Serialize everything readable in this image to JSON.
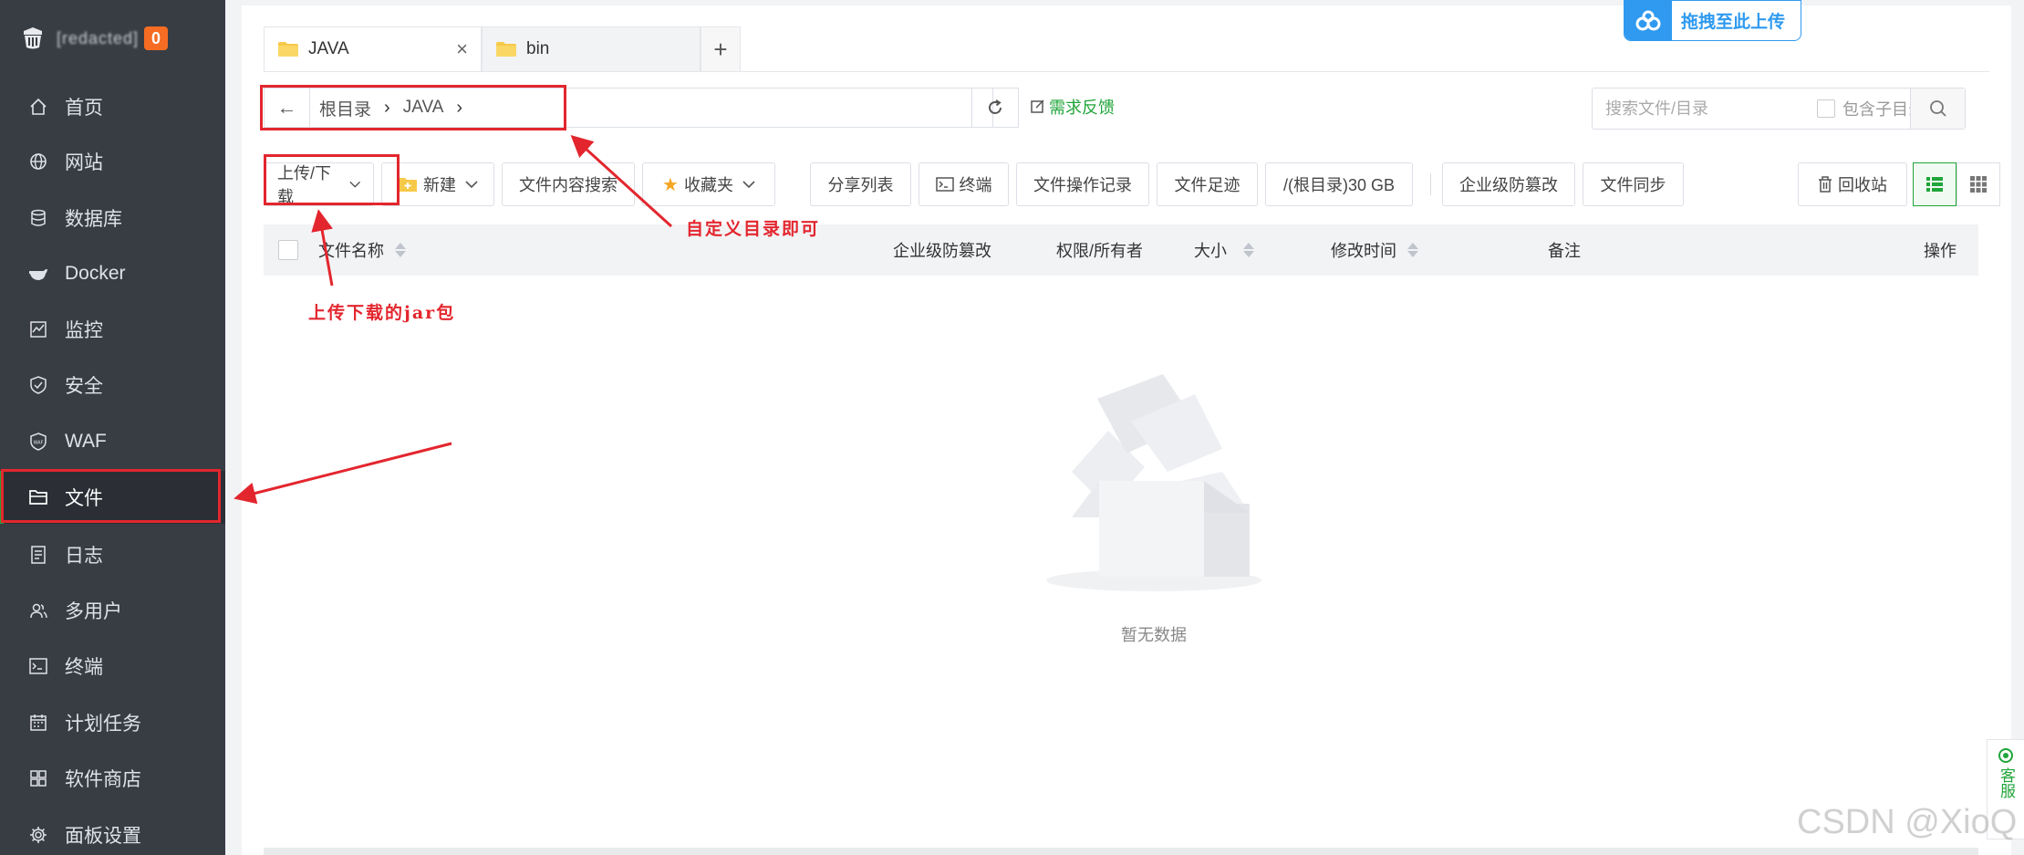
{
  "sidebar": {
    "brand_name": "[redacted]",
    "badge": "0",
    "items": [
      {
        "label": "首页",
        "icon": "home-icon"
      },
      {
        "label": "网站",
        "icon": "globe-icon"
      },
      {
        "label": "数据库",
        "icon": "database-icon"
      },
      {
        "label": "Docker",
        "icon": "docker-icon"
      },
      {
        "label": "监控",
        "icon": "monitor-icon"
      },
      {
        "label": "安全",
        "icon": "shield-icon"
      },
      {
        "label": "WAF",
        "icon": "waf-icon"
      },
      {
        "label": "文件",
        "icon": "folder-icon",
        "active": true
      },
      {
        "label": "日志",
        "icon": "log-icon"
      },
      {
        "label": "多用户",
        "icon": "users-icon"
      },
      {
        "label": "终端",
        "icon": "terminal-icon"
      },
      {
        "label": "计划任务",
        "icon": "calendar-icon"
      },
      {
        "label": "软件商店",
        "icon": "apps-icon"
      },
      {
        "label": "面板设置",
        "icon": "gear-icon"
      }
    ]
  },
  "tabs": [
    {
      "label": "JAVA",
      "active": true
    },
    {
      "label": "bin",
      "active": false
    }
  ],
  "upload_float": {
    "label": "拖拽至此上传"
  },
  "path": {
    "root": "根目录",
    "current": "JAVA"
  },
  "feedback": "需求反馈",
  "search": {
    "placeholder": "搜索文件/目录",
    "include_sub": "包含子目录"
  },
  "toolbar": {
    "upload_download": "上传/下载",
    "new": "新建",
    "content_search": "文件内容搜索",
    "favorites": "收藏夹",
    "share_list": "分享列表",
    "terminal": "终端",
    "op_log": "文件操作记录",
    "footprint": "文件足迹",
    "disk": "/(根目录)30 GB",
    "tamper": "企业级防篡改",
    "sync": "文件同步",
    "recycle": "回收站"
  },
  "table": {
    "headers": {
      "name": "文件名称",
      "tamper": "企业级防篡改",
      "perm": "权限/所有者",
      "size": "大小",
      "mtime": "修改时间",
      "remark": "备注",
      "ops": "操作"
    },
    "empty_text": "暂无数据"
  },
  "annotations": {
    "path_note": "自定义目录即可",
    "upload_note": "上传下载的jar包"
  },
  "side_service": "客服",
  "watermark": "CSDN @XioQ",
  "colors": {
    "accent": "#20a53a",
    "sidebar": "#383d44",
    "annotation": "#e3262e",
    "upload": "#2f9af0"
  }
}
